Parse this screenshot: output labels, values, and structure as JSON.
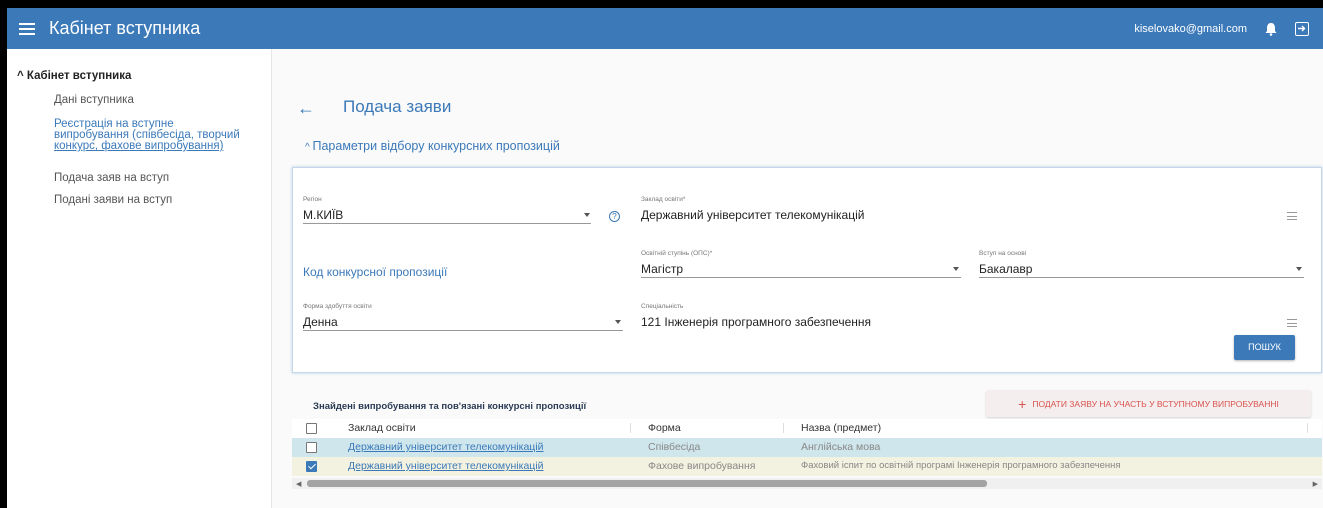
{
  "header": {
    "title": "Кабінет вступника",
    "email": "kiselovako@gmail.com"
  },
  "sidebar": {
    "root_label": "Кабінет вступника",
    "items": [
      {
        "label": "Дані вступника"
      },
      {
        "label_line1": "Реєстрація на вступне",
        "label_line2": "випробування (співбесіда, творчий",
        "label_line3": "конкурс, фахове випробування)"
      },
      {
        "label": "Подача заяв на вступ"
      },
      {
        "label": "Подані заяви на вступ"
      }
    ]
  },
  "page": {
    "title": "Подача заяви",
    "params_title": "Параметри відбору конкурсних пропозицій"
  },
  "form": {
    "region": {
      "label": "Регіон",
      "value": "М.КИЇВ"
    },
    "institution": {
      "label": "Заклад освіти*",
      "value": "Державний університет телекомунікацій"
    },
    "code": {
      "placeholder": "Код конкурсної пропозиції"
    },
    "degree": {
      "label": "Освітній ступінь (ОПС)*",
      "value": "Магістр"
    },
    "basis": {
      "label": "Вступ на основі",
      "value": "Бакалавр"
    },
    "study_form": {
      "label": "Форма здобуття освіти",
      "value": "Денна"
    },
    "specialty": {
      "label": "Спеціальність",
      "value": "121 Інженерія програмного забезпечення"
    },
    "search_button": "ПОШУК"
  },
  "results": {
    "title": "Знайдені випробування та пов'язані конкурсні пропозиції",
    "apply_button": "ПОДАТИ ЗАЯВУ НА УЧАСТЬ У ВСТУПНОМУ ВИПРОБУВАННІ",
    "columns": [
      "Заклад освіти",
      "Форма",
      "Назва (предмет)"
    ],
    "rows": [
      {
        "institution": "Державний університет телекомунікацій",
        "form": "Співбесіда",
        "name": "Англійська мова",
        "checked": false
      },
      {
        "institution": "Державний університет телекомунікацій",
        "form": "Фахове випробування",
        "name": "Фаховий іспит по освітній програмі Інженерія програмного забезпечення",
        "checked": true
      }
    ]
  }
}
